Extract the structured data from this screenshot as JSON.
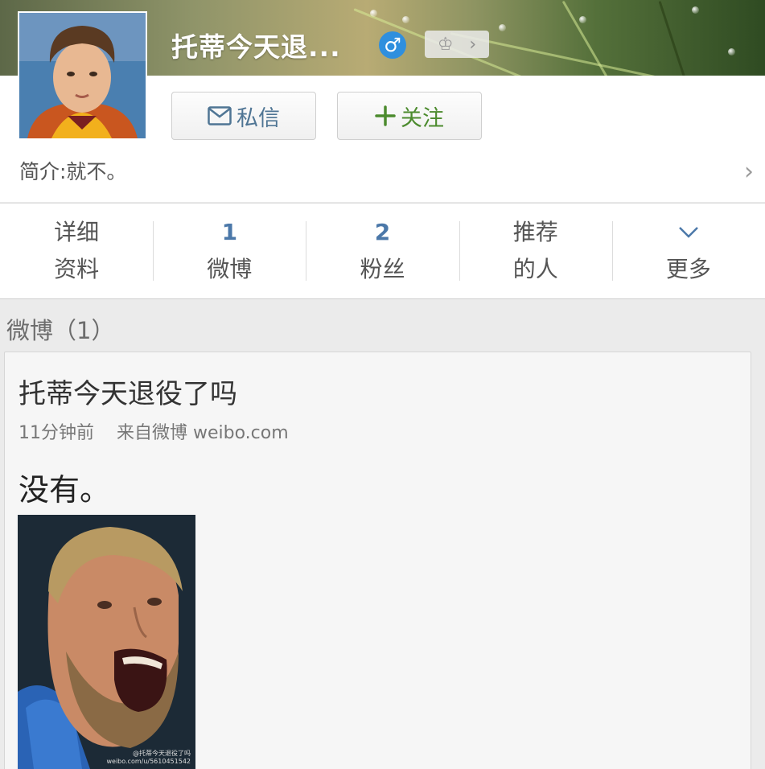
{
  "profile": {
    "name": "托蒂今天退...",
    "gender_symbol": "♂",
    "intro": "简介:就不。",
    "buttons": {
      "message": "私信",
      "follow": "关注"
    }
  },
  "tabs": [
    {
      "line1": "详细",
      "line2": "资料"
    },
    {
      "line1": "1",
      "line2": "微博"
    },
    {
      "line1": "2",
      "line2": "粉丝"
    },
    {
      "line1": "推荐",
      "line2": "的人"
    },
    {
      "line1": "",
      "line2": "更多"
    }
  ],
  "feed": {
    "section_title": "微博（1）",
    "post": {
      "author": "托蒂今天退役了吗",
      "time": "11分钟前",
      "source": "来自微博 weibo.com",
      "text": "没有。",
      "image_watermark_line1": "@托蒂今天退役了吗",
      "image_watermark_line2": "weibo.com/u/5610451542"
    }
  },
  "colors": {
    "link_blue": "#4b78a9",
    "follow_green": "#4c8b2e",
    "gender_blue": "#2f8fde"
  },
  "icons": [
    "gender-male-icon",
    "vip-crown-icon",
    "mail-icon",
    "plus-icon",
    "chevron-right-icon",
    "chevron-down-icon"
  ]
}
